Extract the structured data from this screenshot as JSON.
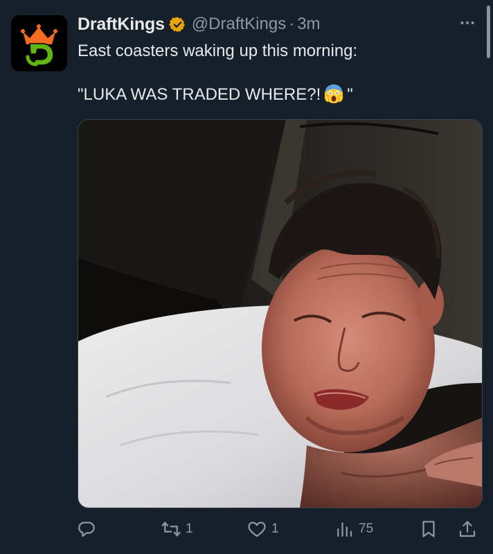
{
  "account": {
    "name": "DraftKings",
    "handle": "@DraftKings",
    "separator": "·",
    "time": "3m",
    "avatar_icon": "draftkings-crown-logo",
    "verified_icon": "verified-badge-icon",
    "verified_color": "#e8a20c"
  },
  "tweet": {
    "line1": "East coasters waking up this morning:",
    "line2_before": "\"LUKA WAS TRADED WHERE?!",
    "line2_emoji": "face-screaming-in-fear-emoji",
    "line2_after": "\""
  },
  "media": {
    "type": "photo",
    "alt": "Man lying on a white pillow grimacing in the dark"
  },
  "actions": {
    "reply": {
      "icon": "reply-icon",
      "count": ""
    },
    "retweet": {
      "icon": "retweet-icon",
      "count": "1"
    },
    "like": {
      "icon": "heart-icon",
      "count": "1"
    },
    "views": {
      "icon": "views-chart-icon",
      "count": "75"
    },
    "bookmark": {
      "icon": "bookmark-icon"
    },
    "share": {
      "icon": "share-icon"
    }
  },
  "colors": {
    "background": "#15202b",
    "text": "#e7e9ea",
    "secondary_text": "#8b98a5",
    "logo_orange": "#f46c22",
    "logo_green": "#61b510"
  }
}
